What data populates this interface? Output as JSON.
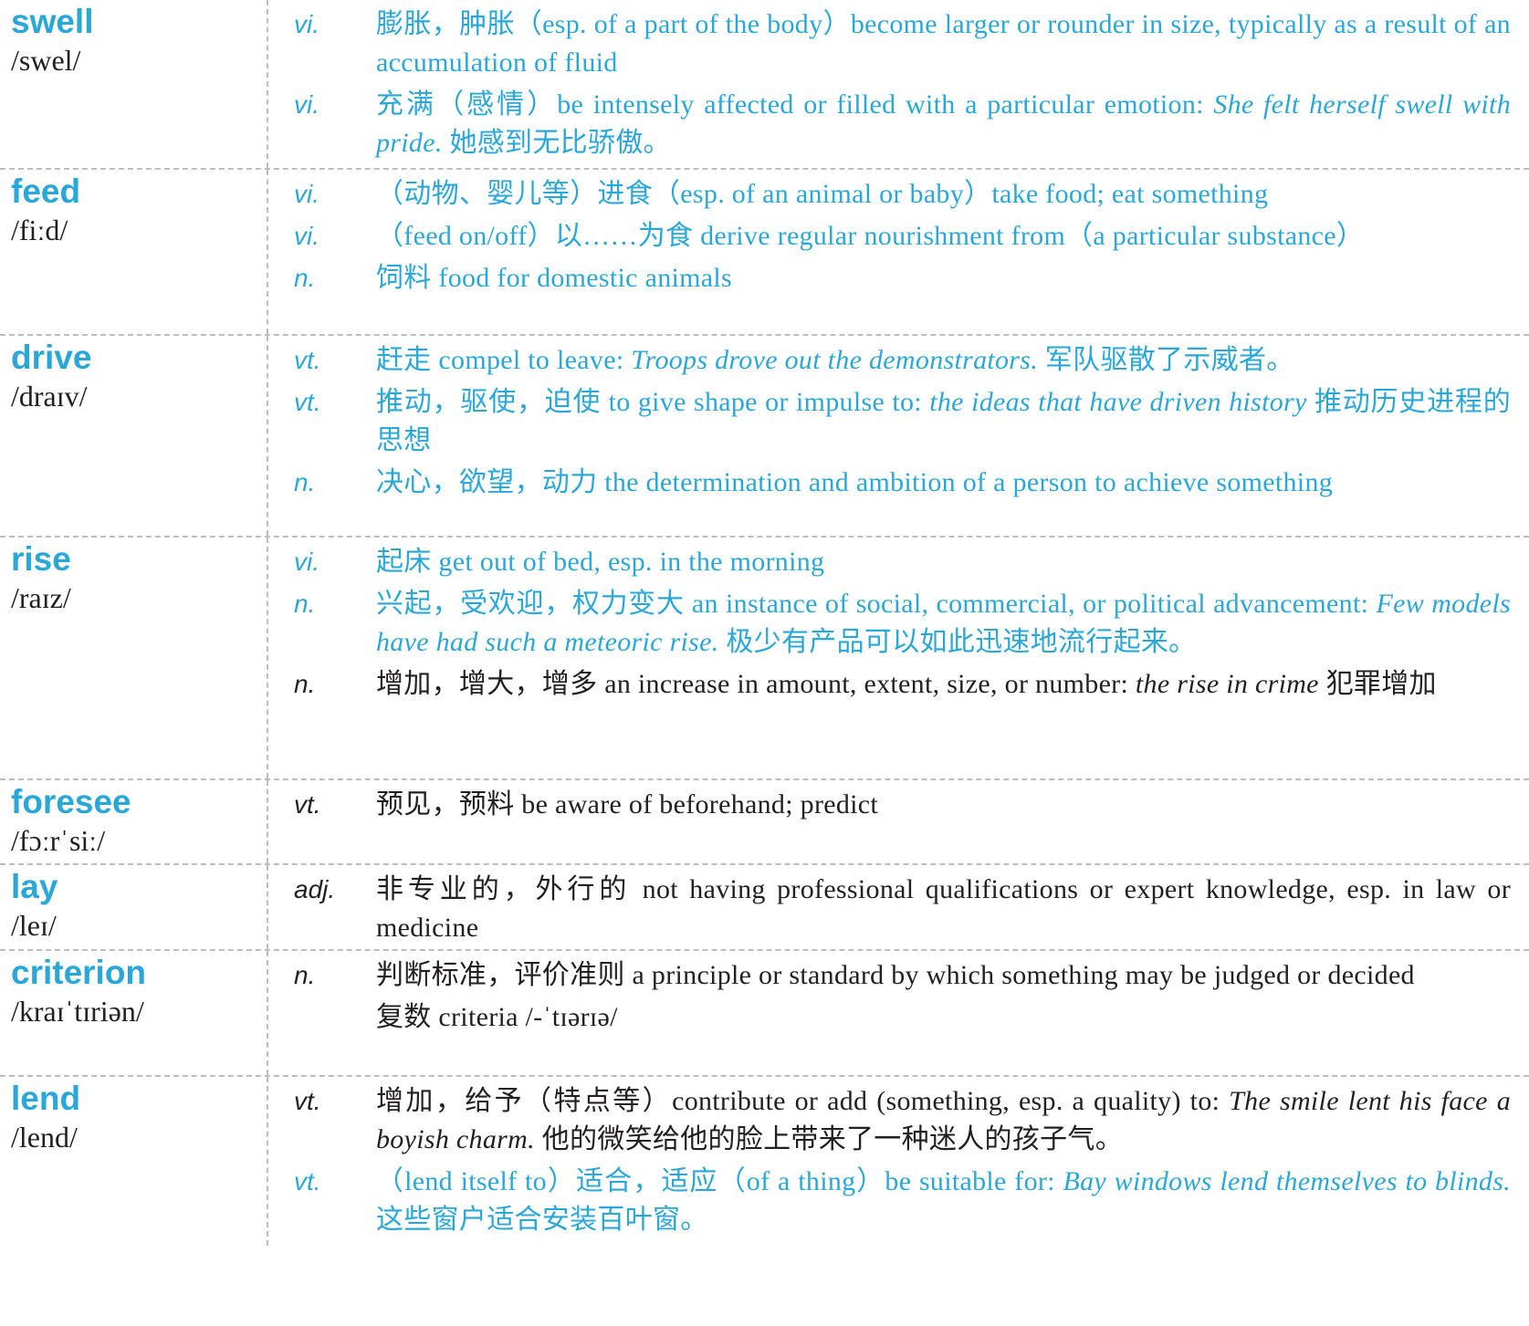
{
  "entries": [
    {
      "word": "swell",
      "phonetic": "/swel/",
      "senses": [
        {
          "pos": "vi.",
          "color": "blue",
          "text": "膨胀，肿胀（esp. of a part of the body）become larger or rounder in size, typically as a result of an accumulation of fluid",
          "example": "",
          "translation": ""
        },
        {
          "pos": "vi.",
          "color": "blue",
          "text": "充满（感情）be intensely affected or filled with a particular emotion: ",
          "example": "She felt herself swell with pride.",
          "translation": " 她感到无比骄傲。"
        }
      ]
    },
    {
      "word": "feed",
      "phonetic": "/fiːd/",
      "senses": [
        {
          "pos": "vi.",
          "color": "blue",
          "text": "（动物、婴儿等）进食（esp. of an animal or baby）take food; eat something",
          "example": "",
          "translation": ""
        },
        {
          "pos": "vi.",
          "color": "blue",
          "text": "（feed on/off）以……为食 derive regular nourishment from（a particular substance）",
          "example": "",
          "translation": ""
        },
        {
          "pos": "n.",
          "color": "blue",
          "text": "饲料 food for domestic animals",
          "example": "",
          "translation": ""
        }
      ]
    },
    {
      "word": "drive",
      "phonetic": "/draɪv/",
      "senses": [
        {
          "pos": "vt.",
          "color": "blue",
          "text": "赶走 compel to leave: ",
          "example": "Troops drove out the demonstrators.",
          "translation": " 军队驱散了示威者。"
        },
        {
          "pos": "vt.",
          "color": "blue",
          "text": "推动，驱使，迫使 to give shape or impulse to: ",
          "example": "the ideas that have driven history",
          "translation": " 推动历史进程的思想"
        },
        {
          "pos": "n.",
          "color": "blue",
          "text": "决心，欲望，动力 the determination and ambition of a person to achieve something",
          "example": "",
          "translation": ""
        }
      ]
    },
    {
      "word": "rise",
      "phonetic": "/raɪz/",
      "senses": [
        {
          "pos": "vi.",
          "color": "blue",
          "text": "起床 get out of bed, esp. in the morning",
          "example": "",
          "translation": ""
        },
        {
          "pos": "n.",
          "color": "blue",
          "text": "兴起，受欢迎，权力变大 an instance of social, commercial, or political advancement: ",
          "example": "Few models have had such a meteoric rise.",
          "translation": " 极少有产品可以如此迅速地流行起来。"
        },
        {
          "pos": "n.",
          "color": "black",
          "text": "增加，增大，增多 an increase in amount, extent, size, or number: ",
          "example": "the rise in crime",
          "translation": " 犯罪增加"
        }
      ]
    },
    {
      "word": "foresee",
      "phonetic": "/fɔːrˈsiː/",
      "senses": [
        {
          "pos": "vt.",
          "color": "black",
          "text": "预见，预料 be aware of beforehand; predict",
          "example": "",
          "translation": ""
        }
      ]
    },
    {
      "word": "lay",
      "phonetic": "/leɪ/",
      "senses": [
        {
          "pos": "adj.",
          "color": "black",
          "text": "非专业的，外行的 not having professional qualifications or expert knowledge, esp. in law or medicine",
          "example": "",
          "translation": ""
        }
      ]
    },
    {
      "word": "criterion",
      "phonetic": "/kraɪˈtɪriən/",
      "senses": [
        {
          "pos": "n.",
          "color": "black",
          "text": "判断标准，评价准则 a principle or standard by which something may be judged or decided",
          "example": "",
          "translation": ""
        },
        {
          "pos": "",
          "color": "black",
          "text": "复数 criteria /-ˈtɪərɪə/",
          "example": "",
          "translation": ""
        }
      ]
    },
    {
      "word": "lend",
      "phonetic": "/lend/",
      "senses": [
        {
          "pos": "vt.",
          "color": "black",
          "text": "增加，给予（特点等）contribute or add (something, esp. a quality) to: ",
          "example": "The smile lent his face a boyish charm.",
          "translation": " 他的微笑给他的脸上带来了一种迷人的孩子气。"
        },
        {
          "pos": "vt.",
          "color": "blue",
          "text": "（lend itself to）适合，适应（of a thing）be suitable for: ",
          "example": "Bay windows lend themselves to blinds.",
          "translation": " 这些窗户适合安装百叶窗。"
        }
      ]
    }
  ]
}
